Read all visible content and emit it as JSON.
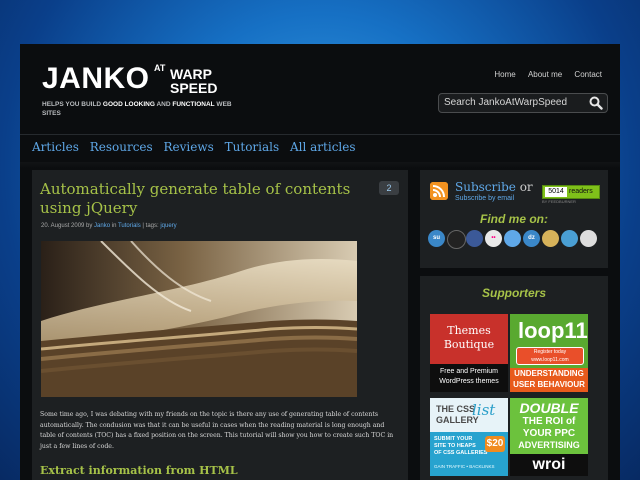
{
  "header": {
    "logo_main": "JANKO",
    "logo_at": "AT",
    "logo_warp": "WARP",
    "logo_speed": "SPEED",
    "tagline": {
      "p1": "HELPS YOU BUILD ",
      "p2": "GOOD LOOKING",
      "p3": " AND ",
      "p4": "FUNCTIONAL",
      "p5": " WEB SITES"
    },
    "topnav": [
      "Home",
      "About me",
      "Contact"
    ],
    "search_placeholder": "Search JankoAtWarpSpeed"
  },
  "mainnav": [
    "Articles",
    "Resources",
    "Reviews",
    "Tutorials",
    "All articles"
  ],
  "post": {
    "title": "Automatically generate table of contents using jQuery",
    "comment_count": "2",
    "meta_date": "20. August 2009 by ",
    "meta_author": "Janko",
    "meta_in": " in ",
    "meta_category": "Tutorials",
    "meta_tags_label": " | tags: ",
    "meta_tag": "jquery",
    "intro": "Some time ago, I was debating with my friends on the topic is there any use of generating table of contents automatically. The condusion was that it can be useful in cases when the reading material is long enough and table of contents (TOC) has a fixed position on the screen. This tutorial will show you how to create such TOC in just a few lines of code.",
    "subheading": "Extract information from HTML"
  },
  "sidebar": {
    "subscribe": "Subscribe",
    "or": " or",
    "subscribe_email": "Subscribe by email",
    "readers_count": "5014",
    "readers_label": "readers",
    "burner": "BY FEEDBURNER",
    "find_me": "Find me on:",
    "social": [
      {
        "label": "su",
        "color": "#3a87c8"
      },
      {
        "label": "",
        "color": "#222222"
      },
      {
        "label": "",
        "color": "#3b5998"
      },
      {
        "label": "••",
        "color": "#e9e9e9"
      },
      {
        "label": "",
        "color": "#5fa8e8"
      },
      {
        "label": "dz",
        "color": "#3a87c8"
      },
      {
        "label": "",
        "color": "#d6b25a"
      },
      {
        "label": "",
        "color": "#4a9fd4"
      },
      {
        "label": "",
        "color": "#dddddd"
      }
    ],
    "supporters": "Supporters",
    "ads": {
      "a1_line1": "Themes",
      "a1_line2": "Boutique",
      "a1_line3": "Free and Premium",
      "a1_line4": "WordPress themes",
      "a2_logo": "loop11",
      "a2_btn": "Register today www.loop11.com",
      "a2_bar1": "UNDERSTANDING",
      "a2_bar2": "USER BEHAVIOUR",
      "a3_t1": "THE CSS",
      "a3_t2": "GALLERY",
      "a3_list": "list",
      "a3_b1": "SUBMIT YOUR",
      "a3_b2": "SITE TO HEAPS",
      "a3_b3": "OF CSS GALLERIES",
      "a3_price": "$20",
      "a3_b4": "GAIN TRAFFIC • BACKLINKS",
      "a4_t1": "DOUBLE",
      "a4_t2": "THE ROI of",
      "a4_t3": "YOUR PPC",
      "a4_t4": "ADVERTISING",
      "a4_logo": "wroi"
    }
  }
}
